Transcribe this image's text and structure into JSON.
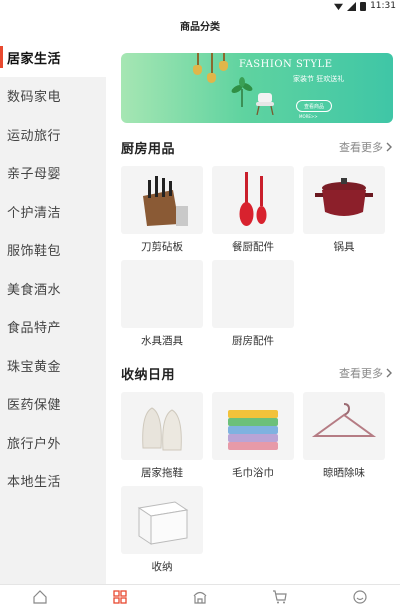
{
  "status": {
    "time": "11:31"
  },
  "header": {
    "title": "商品分类"
  },
  "sidebar": {
    "items": [
      {
        "label": "居家生活",
        "active": true
      },
      {
        "label": "数码家电"
      },
      {
        "label": "运动旅行"
      },
      {
        "label": "亲子母婴"
      },
      {
        "label": "个护清洁"
      },
      {
        "label": "服饰鞋包"
      },
      {
        "label": "美食酒水"
      },
      {
        "label": "食品特产"
      },
      {
        "label": "珠宝黄金"
      },
      {
        "label": "医药保健"
      },
      {
        "label": "旅行户外"
      },
      {
        "label": "本地生活"
      }
    ]
  },
  "banner": {
    "title": "FASHION STYLE",
    "subtitle": "家装节 狂欢送礼",
    "button": "查看商品",
    "tiny": "MORE>>"
  },
  "sections": [
    {
      "title": "厨房用品",
      "more": "查看更多",
      "items": [
        {
          "label": "刀剪砧板",
          "icon": "knife-block-icon"
        },
        {
          "label": "餐厨配件",
          "icon": "spatula-icon"
        },
        {
          "label": "锅具",
          "icon": "pot-icon"
        },
        {
          "label": "水具酒具",
          "icon": "placeholder"
        },
        {
          "label": "厨房配件",
          "icon": "placeholder"
        }
      ]
    },
    {
      "title": "收纳日用",
      "more": "查看更多",
      "items": [
        {
          "label": "居家拖鞋",
          "icon": "slippers-icon"
        },
        {
          "label": "毛巾浴巾",
          "icon": "towels-icon"
        },
        {
          "label": "晾晒除味",
          "icon": "hanger-icon"
        },
        {
          "label": "收纳",
          "icon": "storage-box-icon"
        }
      ]
    }
  ],
  "tabbar": {
    "tabs": [
      {
        "icon": "home-icon",
        "active": false
      },
      {
        "icon": "category-icon",
        "active": true
      },
      {
        "icon": "store-icon",
        "active": false
      },
      {
        "icon": "cart-icon",
        "active": false
      },
      {
        "icon": "profile-icon",
        "active": false
      }
    ]
  },
  "colors": {
    "accent": "#e8492f",
    "sidebar_bg": "#f2f2f2",
    "banner": "#5fd3a0"
  }
}
